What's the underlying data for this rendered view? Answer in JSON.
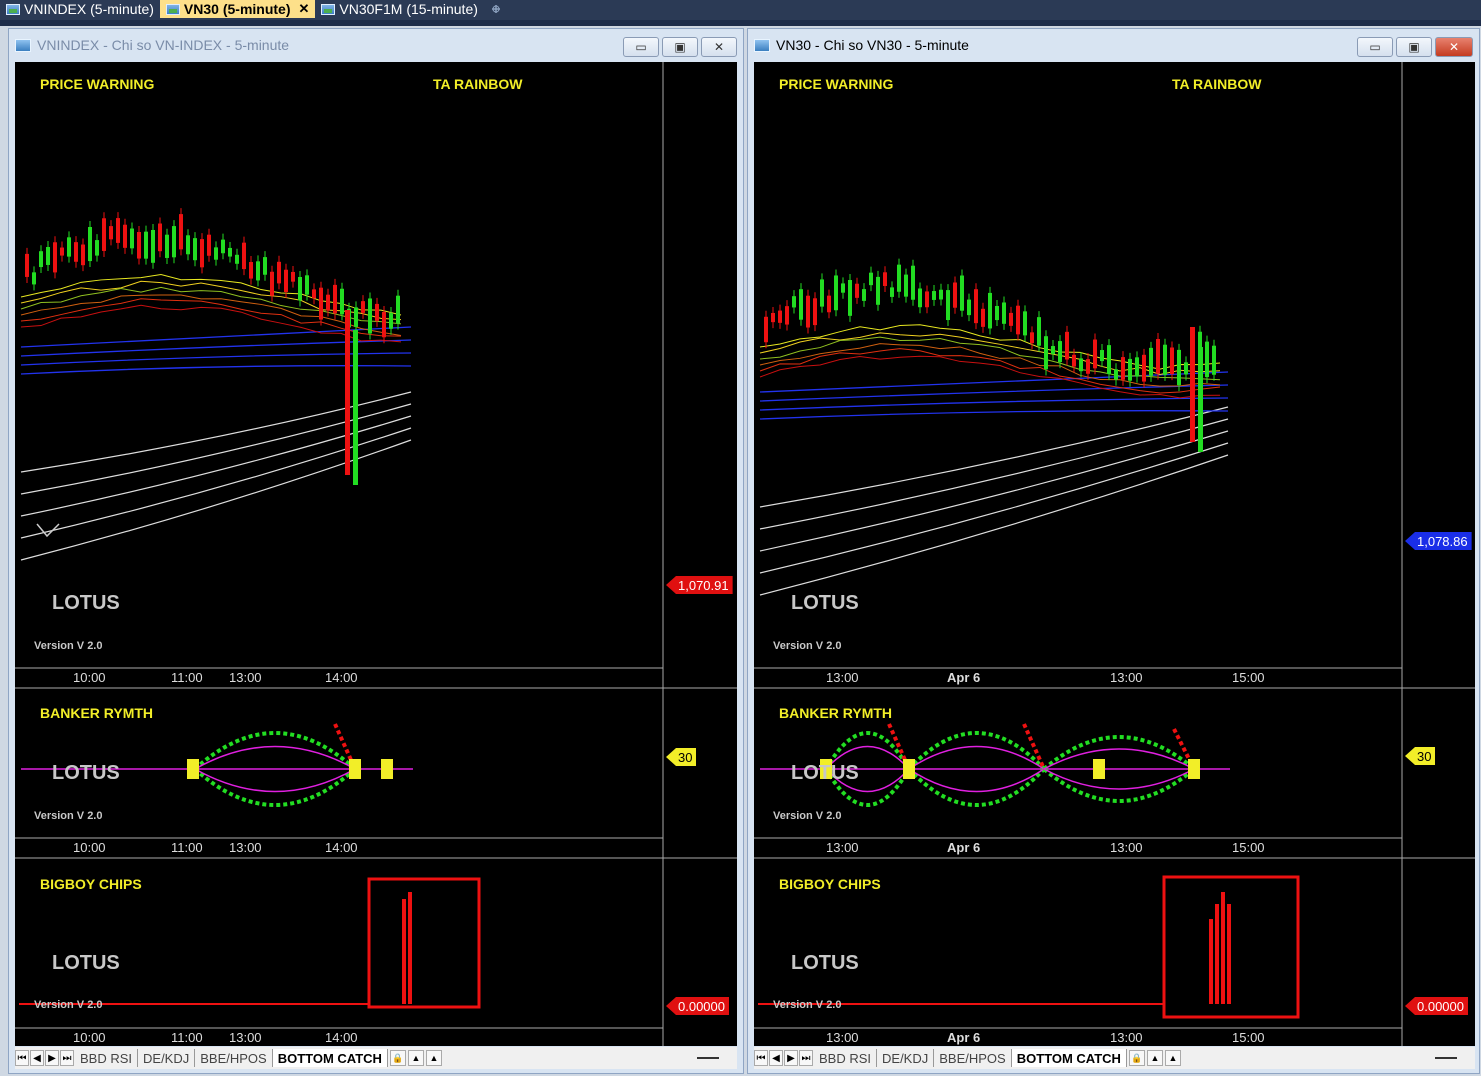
{
  "doc_tabs": [
    {
      "label": "VNINDEX (5-minute)",
      "active": false
    },
    {
      "label": "VN30 (5-minute)",
      "active": true
    },
    {
      "label": "VN30F1M (15-minute)",
      "active": false
    }
  ],
  "tab_close_symbol": "✕",
  "windows": [
    {
      "title": "VNINDEX - Chi so VN-INDEX - 5-minute",
      "price_warning": "PRICE WARNING",
      "ta_rainbow": "TA RAINBOW",
      "banker_rymth": "BANKER RYMTH",
      "bigboy_chips": "BIGBOY CHIPS",
      "lotus": "LOTUS",
      "version": "Version V 2.0",
      "axis_labels": [
        "10:00",
        "11:00",
        "13:00",
        "14:00"
      ],
      "axis_bold": [
        false,
        false,
        false,
        false
      ],
      "price_tag": "1,070.91",
      "osc_tag": "30",
      "chips_tag": "0.00000"
    },
    {
      "title": "VN30 - Chi so VN30 - 5-minute",
      "price_warning": "PRICE WARNING",
      "ta_rainbow": "TA RAINBOW",
      "banker_rymth": "BANKER RYMTH",
      "bigboy_chips": "BIGBOY CHIPS",
      "lotus": "LOTUS",
      "version": "Version V 2.0",
      "axis_labels": [
        "13:00",
        "Apr 6",
        "13:00",
        "15:00"
      ],
      "axis_bold": [
        false,
        true,
        false,
        false
      ],
      "price_tag": "1,078.86",
      "osc_tag": "30",
      "chips_tag": "0.00000"
    }
  ],
  "bottom_tabs": [
    "BBD RSI",
    "DE/KDJ",
    "BBE/HPOS",
    "BOTTOM CATCH"
  ],
  "bottom_active": "BOTTOM CATCH",
  "colors": {
    "label_yellow": "#f2ee28",
    "bull": "#22dd22",
    "bear": "#ee1111",
    "ma_blue": "#2233ee",
    "magenta": "#e020e0"
  }
}
